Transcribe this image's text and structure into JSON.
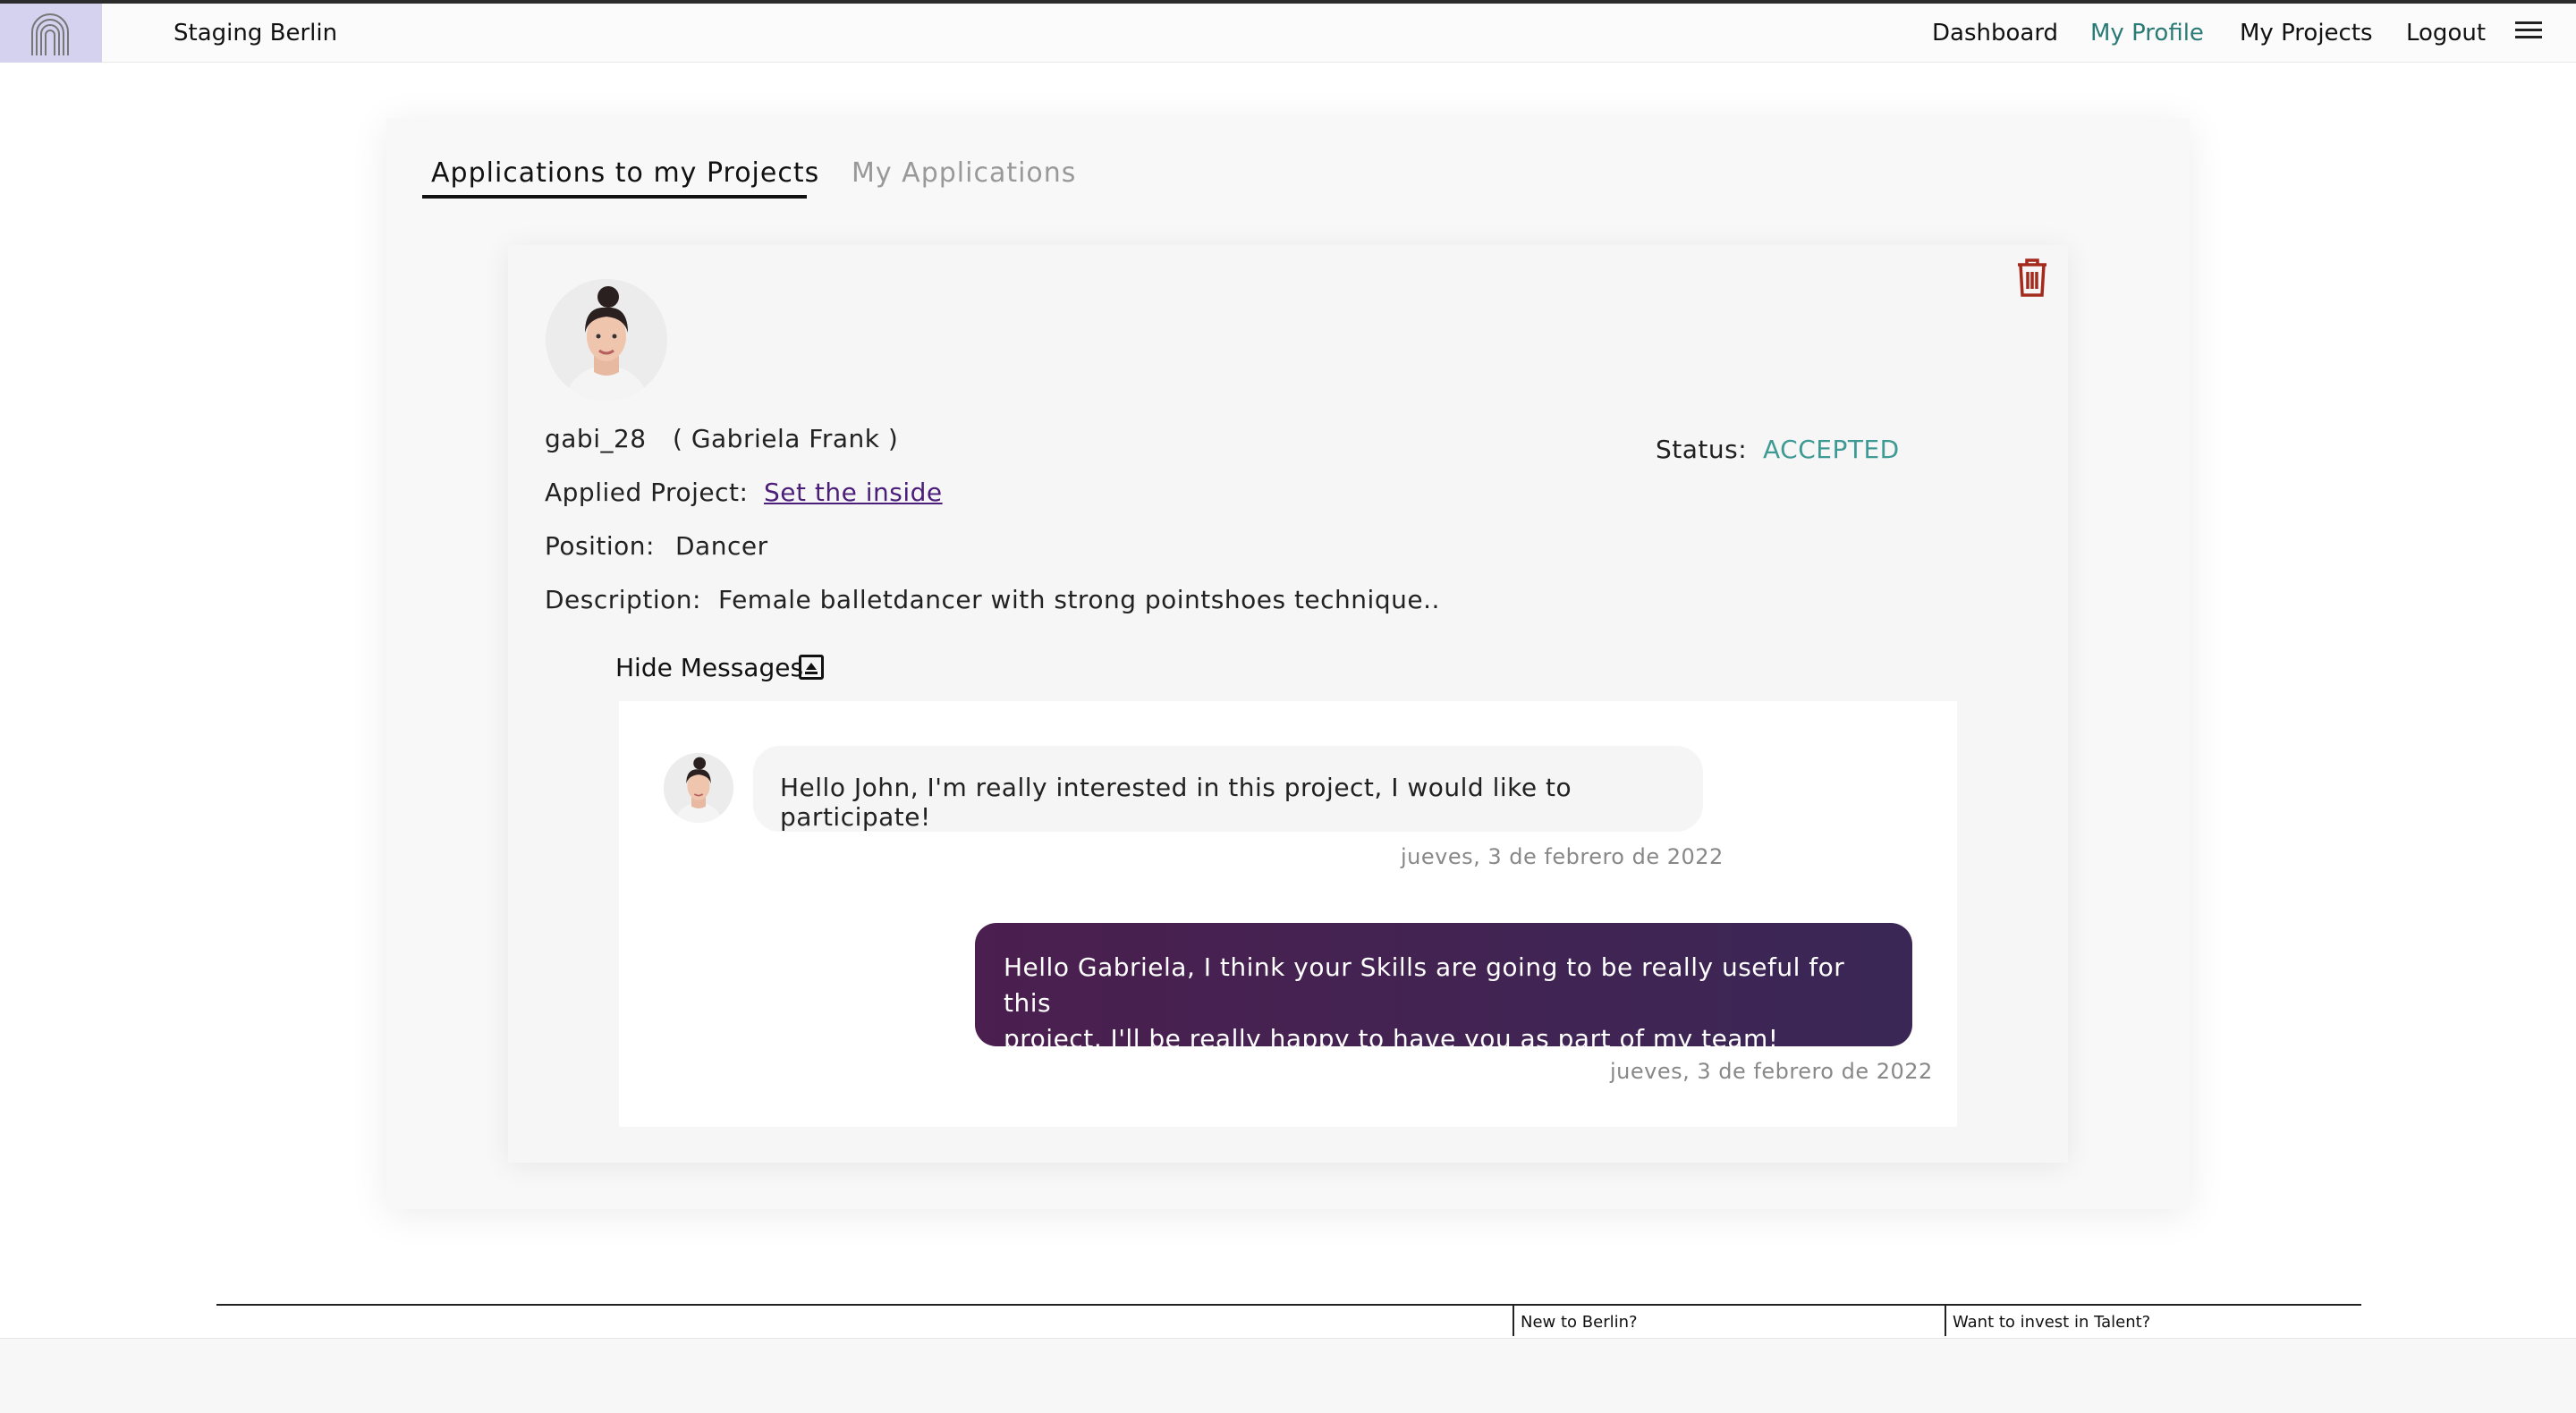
{
  "header": {
    "brand": "Staging Berlin",
    "nav": [
      {
        "label": "Dashboard",
        "active": false
      },
      {
        "label": "My Profile",
        "active": true
      },
      {
        "label": "My Projects",
        "active": false
      },
      {
        "label": "Logout",
        "active": false
      }
    ],
    "menu_icon": "hamburger-icon",
    "logo_icon": "arches-logo-icon"
  },
  "tabs": [
    {
      "label": "Applications to my Projects",
      "active": true
    },
    {
      "label": "My Applications",
      "active": false
    }
  ],
  "application": {
    "username": "gabi_28",
    "fullname": "( Gabriela Frank )",
    "status_label": "Status:",
    "status_value": "ACCEPTED",
    "project_label": "Applied Project:",
    "project_value": "Set the inside",
    "position_label": "Position:",
    "position_value": "Dancer",
    "description_label": "Description:",
    "description_value": "Female balletdancer with strong pointshoes technique..",
    "toggle_label": "Hide Messages",
    "delete_icon": "trash-icon"
  },
  "messages": [
    {
      "text": "Hello John, I'm really interested in this project, I would like to participate!",
      "date": "jueves, 3 de febrero de 2022",
      "direction": "incoming"
    },
    {
      "text_line1": "Hello Gabriela, I think your Skills are going to be really useful for this",
      "text_line2": "project, I'll be really happy to have you as part of my team!",
      "date": "jueves, 3 de febrero de 2022",
      "direction": "outgoing"
    }
  ],
  "footer": {
    "links": [
      "New to Berlin?",
      "Want to invest in Talent?"
    ]
  },
  "colors": {
    "accent": "#2a7a76",
    "status": "#3e9a94",
    "link": "#4b1e7a",
    "bubble_out": "#3f2352",
    "trash": "#a52a1e"
  }
}
